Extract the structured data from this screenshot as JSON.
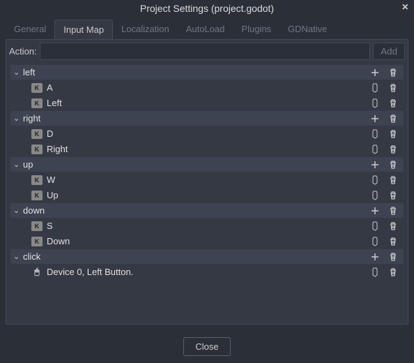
{
  "title": "Project Settings (project.godot)",
  "tabs": {
    "general": "General",
    "input_map": "Input Map",
    "localization": "Localization",
    "autoload": "AutoLoad",
    "plugins": "Plugins",
    "gdnative": "GDNative",
    "active": "input_map"
  },
  "action_label": "Action:",
  "action_value": "",
  "add_label": "Add",
  "close_label": "Close",
  "actions": [
    {
      "name": "left",
      "events": [
        {
          "type": "key",
          "label": "A"
        },
        {
          "type": "key",
          "label": "Left"
        }
      ]
    },
    {
      "name": "right",
      "events": [
        {
          "type": "key",
          "label": "D"
        },
        {
          "type": "key",
          "label": "Right"
        }
      ]
    },
    {
      "name": "up",
      "events": [
        {
          "type": "key",
          "label": "W"
        },
        {
          "type": "key",
          "label": "Up"
        }
      ]
    },
    {
      "name": "down",
      "events": [
        {
          "type": "key",
          "label": "S"
        },
        {
          "type": "key",
          "label": "Down"
        }
      ]
    },
    {
      "name": "click",
      "events": [
        {
          "type": "mouse",
          "label": "Device 0, Left Button."
        }
      ]
    }
  ]
}
